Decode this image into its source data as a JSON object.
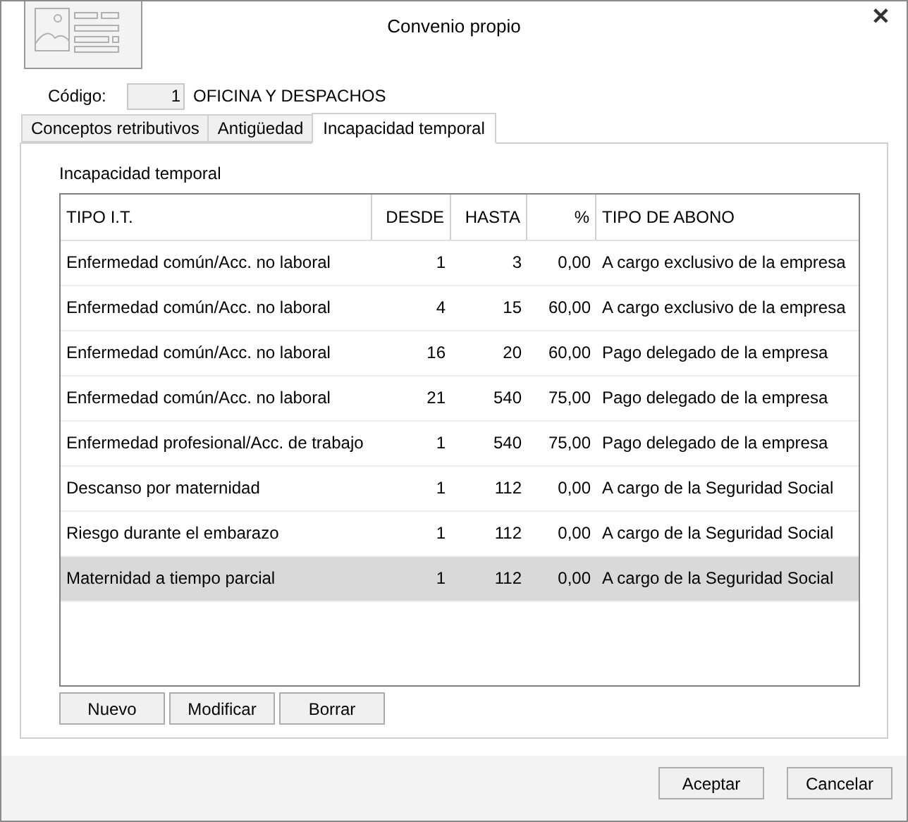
{
  "window": {
    "title": "Convenio propio",
    "close": "✕"
  },
  "codigo": {
    "label": "Código:",
    "value": "1",
    "name": "OFICINA Y DESPACHOS"
  },
  "tabs": [
    {
      "label": "Conceptos retributivos",
      "selected": false
    },
    {
      "label": "Antigüedad",
      "selected": false
    },
    {
      "label": "Incapacidad temporal",
      "selected": true
    }
  ],
  "section_title": "Incapacidad temporal",
  "table": {
    "columns": [
      "TIPO I.T.",
      "DESDE",
      "HASTA",
      "%",
      "TIPO DE ABONO"
    ],
    "rows": [
      {
        "cells": [
          "Enfermedad común/Acc. no laboral",
          "1",
          "3",
          "0,00",
          "A cargo exclusivo de la empresa"
        ],
        "selected": false
      },
      {
        "cells": [
          "Enfermedad común/Acc. no laboral",
          "4",
          "15",
          "60,00",
          "A cargo exclusivo de la empresa"
        ],
        "selected": false
      },
      {
        "cells": [
          "Enfermedad común/Acc. no laboral",
          "16",
          "20",
          "60,00",
          "Pago delegado de la empresa"
        ],
        "selected": false
      },
      {
        "cells": [
          "Enfermedad común/Acc. no laboral",
          "21",
          "540",
          "75,00",
          "Pago delegado de la empresa"
        ],
        "selected": false
      },
      {
        "cells": [
          "Enfermedad profesional/Acc. de trabajo",
          "1",
          "540",
          "75,00",
          "Pago delegado de la empresa"
        ],
        "selected": false
      },
      {
        "cells": [
          "Descanso por maternidad",
          "1",
          "112",
          "0,00",
          "A cargo de la Seguridad Social"
        ],
        "selected": false
      },
      {
        "cells": [
          "Riesgo durante el embarazo",
          "1",
          "112",
          "0,00",
          "A cargo de la Seguridad Social"
        ],
        "selected": false
      },
      {
        "cells": [
          "Maternidad a tiempo parcial",
          "1",
          "112",
          "0,00",
          "A cargo de la Seguridad Social"
        ],
        "selected": true
      }
    ]
  },
  "table_buttons": [
    "Nuevo",
    "Modificar",
    "Borrar"
  ],
  "footer_buttons": [
    "Aceptar",
    "Cancelar"
  ]
}
